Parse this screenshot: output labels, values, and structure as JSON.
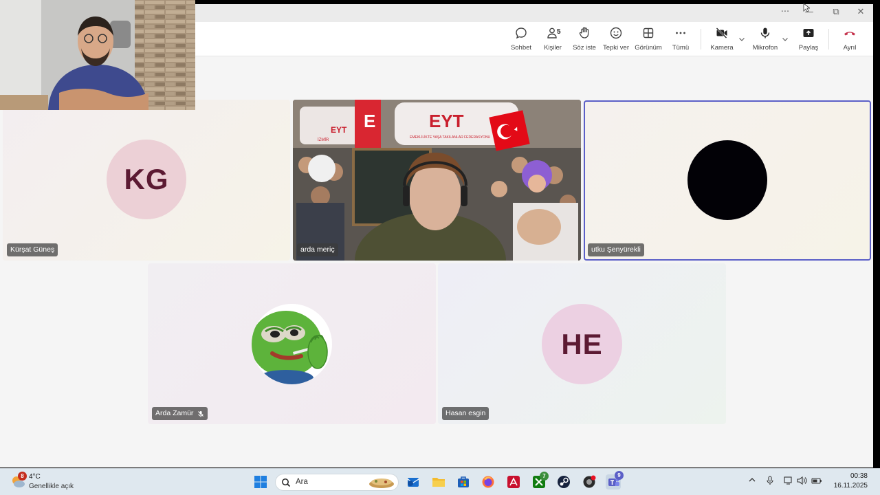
{
  "window": {
    "controls": {
      "more": "···",
      "minimize": "—",
      "restore": "⧉",
      "close": "✕"
    }
  },
  "toolbar": {
    "chat": "Sohbet",
    "people": "Kişiler",
    "people_count": "5",
    "raise_hand": "Söz iste",
    "react": "Tepki ver",
    "view": "Görünüm",
    "more": "Tümü",
    "camera": "Kamera",
    "mic": "Mikrofon",
    "share": "Paylaş",
    "leave": "Ayrıl"
  },
  "participants": [
    {
      "name": "Kürşat Güneş",
      "initials": "KG"
    },
    {
      "name": "arda meriç"
    },
    {
      "name": "utku Şenyürekli"
    },
    {
      "name": "Arda Zamür"
    },
    {
      "name": "Hasan esgin",
      "initials": "HE"
    }
  ],
  "video_scene": {
    "banner_text": "EYT",
    "banner_sub": "EMEKLİLİKTE YAŞA TAKILANLAR FEDERASYONU",
    "banner_city": "İZMİR"
  },
  "taskbar": {
    "weather_temp": "4°C",
    "weather_desc": "Genellikle açık",
    "weather_badge": "8",
    "search_placeholder": "Ara",
    "xbox_badge": "7",
    "teams_badge": "9",
    "time": "00:38",
    "date": "16.11.2025"
  },
  "colors": {
    "accent": "#5b5fc7",
    "leave": "#c4314b",
    "kg_avatar": "#ecd0d6",
    "he_avatar": "#ecd0e2",
    "initials": "#5c1a33"
  }
}
